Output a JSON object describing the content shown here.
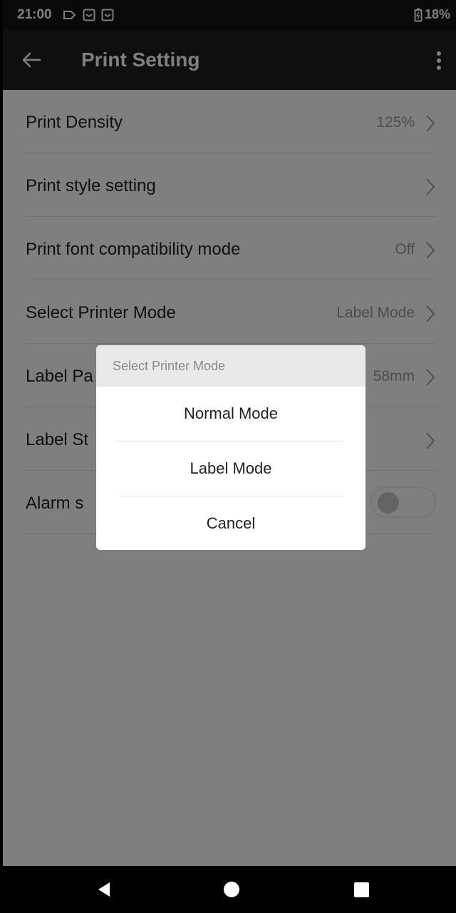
{
  "status_bar": {
    "time": "21:00",
    "battery": "18%"
  },
  "app_bar": {
    "title": "Print Setting"
  },
  "settings": {
    "rows": [
      {
        "label": "Print Density",
        "value": "125%"
      },
      {
        "label": "Print style setting",
        "value": ""
      },
      {
        "label": "Print font compatibility mode",
        "value": "Off"
      },
      {
        "label": "Select Printer Mode",
        "value": "Label Mode"
      },
      {
        "label": "Label Pa",
        "value": "58mm"
      },
      {
        "label": "Label St",
        "value": ""
      },
      {
        "label": "Alarm s",
        "value": ""
      }
    ],
    "alarm_toggle": {
      "state": "off"
    }
  },
  "dialog": {
    "title": "Select Printer Mode",
    "options": [
      "Normal Mode",
      "Label Mode",
      "Cancel"
    ]
  },
  "colors": {
    "status_bar": "#121212",
    "app_bar": "#1f1f1f",
    "scrim": "rgba(0,0,0,0.5)"
  }
}
